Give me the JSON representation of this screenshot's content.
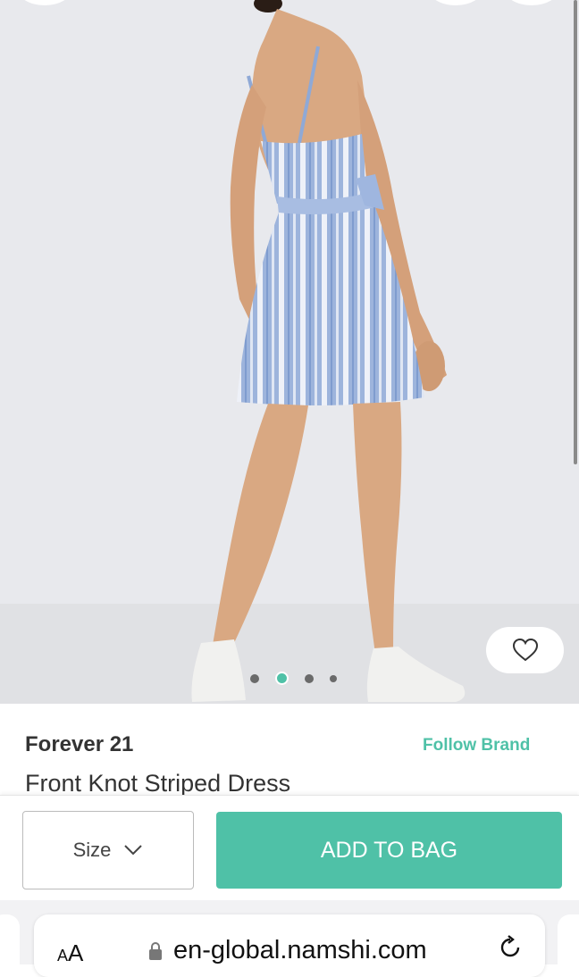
{
  "gallery": {
    "image_alt": "Model wearing blue and white striped dress, back view",
    "current_index": 2,
    "total_images": 4
  },
  "product": {
    "brand": "Forever 21",
    "follow_label": "Follow Brand",
    "name": "Front Knot Striped Dress"
  },
  "actions": {
    "size_label": "Size",
    "add_to_bag_label": "ADD TO BAG"
  },
  "browser": {
    "text_size_label_small": "A",
    "text_size_label_large": "A",
    "url": "en-global.namshi.com"
  },
  "colors": {
    "accent": "#4fc1a7",
    "background_grey": "#e8e9ed"
  }
}
